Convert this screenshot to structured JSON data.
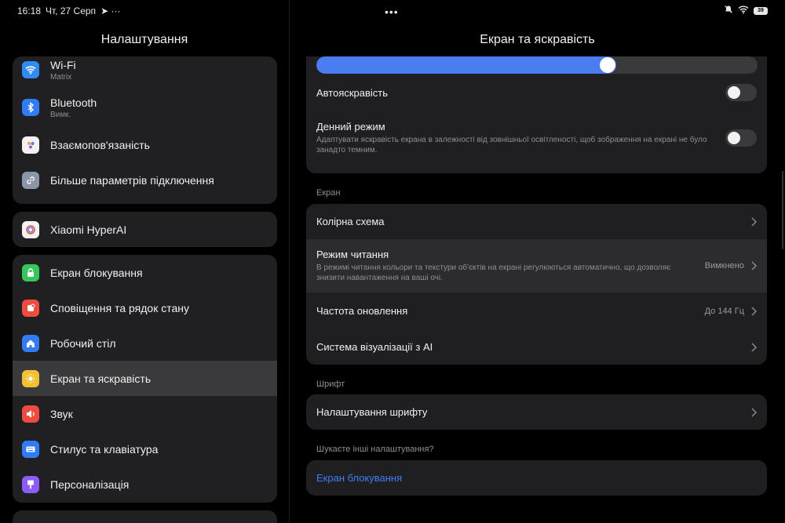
{
  "status": {
    "time": "16:18",
    "date": "Чт, 27 Серп",
    "extra": "➤ ···",
    "mid_dots": "•••",
    "battery": "39"
  },
  "left": {
    "title": "Налаштування",
    "groups": [
      {
        "items": [
          {
            "label": "Wi-Fi",
            "sub": "Matrix",
            "icon": "wifi-icon",
            "color": "#2f8cf5"
          },
          {
            "label": "Bluetooth",
            "sub": "Вимк.",
            "icon": "bluetooth-icon",
            "color": "#2f7cf5"
          },
          {
            "label": "Взаємопов'язаність",
            "icon": "connectivity-icon",
            "color": "#f2f2f2"
          },
          {
            "label": "Більше параметрів підключення",
            "icon": "link-icon",
            "color": "#8a95a5"
          }
        ]
      },
      {
        "items": [
          {
            "label": "Xiaomi HyperAI",
            "icon": "hyperai-icon",
            "color": "#f2f2f2"
          }
        ]
      },
      {
        "items": [
          {
            "label": "Екран блокування",
            "icon": "lock-icon",
            "color": "#34c759"
          },
          {
            "label": "Сповіщення та рядок стану",
            "icon": "notification-icon",
            "color": "#ef4b3f"
          },
          {
            "label": "Робочий стіл",
            "icon": "home-icon",
            "color": "#2f7cf5"
          },
          {
            "label": "Екран та яскравість",
            "icon": "sun-icon",
            "color": "#f5c02f"
          },
          {
            "label": "Звук",
            "icon": "speaker-icon",
            "color": "#ef4b3f"
          },
          {
            "label": "Стилус та клавіатура",
            "icon": "keyboard-icon",
            "color": "#2f7cf5"
          },
          {
            "label": "Персоналізація",
            "icon": "brush-icon",
            "color": "#8b5cf6"
          }
        ]
      }
    ]
  },
  "right": {
    "title": "Екран та яскравість",
    "brightness_level": 0.68,
    "auto_brightness": {
      "label": "Автояскравість",
      "on": false
    },
    "day_mode": {
      "label": "Денний режим",
      "desc": "Адаптувати яскравість екрана в залежності від зовнішньої освітленості, щоб зображення на екрані не було занадто темним.",
      "on": false
    },
    "section_screen": "Екран",
    "color_scheme": "Колірна схема",
    "reading_mode": {
      "label": "Режим читання",
      "desc": "В режимі читання кольори та текстури об'єктів на екрані регулюються автоматично, що дозволяє знизити навантаження на ваші очі.",
      "value": "Вимкнено"
    },
    "refresh_rate": {
      "label": "Частота оновлення",
      "value": "До 144 Гц"
    },
    "ai_visual": "Система візуалізації з AI",
    "section_font": "Шрифт",
    "font_settings": "Налаштування шрифту",
    "section_more": "Шукаєте інші налаштування?",
    "lock_screen_link": "Екран блокування"
  },
  "colors": {
    "accent": "#4a7df0",
    "link": "#3d7ef5",
    "selected": "#3a3a3c"
  }
}
